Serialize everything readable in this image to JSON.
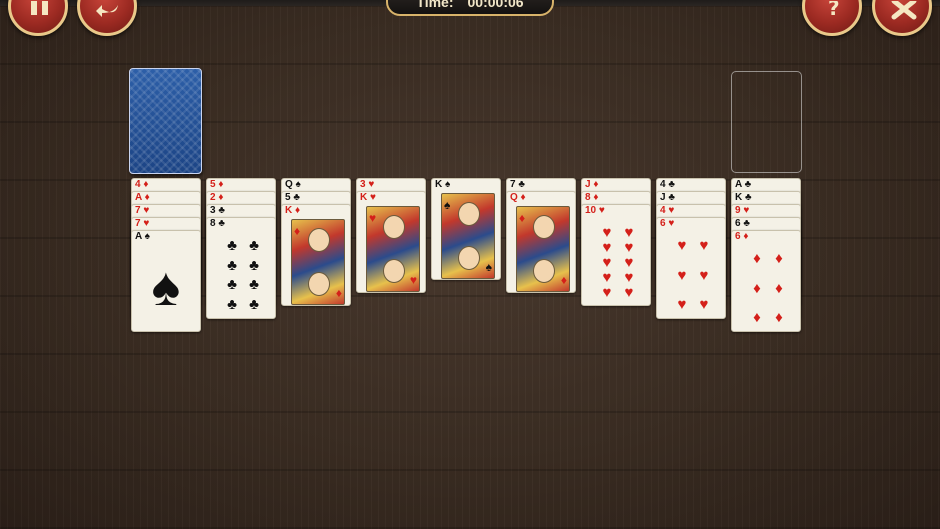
{
  "header": {
    "timer_label": "Time:",
    "timer_value": "00:00:06",
    "pause_icon": "pause-icon",
    "undo_icon": "undo-icon",
    "help_icon": "help-icon",
    "close_icon": "close-icon"
  },
  "colors": {
    "button_red": "#9c2a22",
    "button_border": "#e9c98a",
    "suit_red": "#d4201a",
    "card_back": "#1c4485"
  },
  "tableau": [
    {
      "cards": [
        {
          "rank": "4",
          "suit": "♦"
        },
        {
          "rank": "A",
          "suit": "♦"
        },
        {
          "rank": "7",
          "suit": "♥"
        },
        {
          "rank": "7",
          "suit": "♥"
        },
        {
          "rank": "A",
          "suit": "♠"
        }
      ]
    },
    {
      "cards": [
        {
          "rank": "5",
          "suit": "♦"
        },
        {
          "rank": "2",
          "suit": "♦"
        },
        {
          "rank": "3",
          "suit": "♣"
        },
        {
          "rank": "8",
          "suit": "♣"
        }
      ]
    },
    {
      "cards": [
        {
          "rank": "Q",
          "suit": "♠"
        },
        {
          "rank": "5",
          "suit": "♣"
        },
        {
          "rank": "K",
          "suit": "♦"
        }
      ]
    },
    {
      "cards": [
        {
          "rank": "3",
          "suit": "♥"
        },
        {
          "rank": "K",
          "suit": "♥"
        }
      ]
    },
    {
      "cards": [
        {
          "rank": "K",
          "suit": "♠"
        }
      ]
    },
    {
      "cards": [
        {
          "rank": "7",
          "suit": "♣"
        },
        {
          "rank": "Q",
          "suit": "♦"
        }
      ]
    },
    {
      "cards": [
        {
          "rank": "J",
          "suit": "♦"
        },
        {
          "rank": "8",
          "suit": "♦"
        },
        {
          "rank": "10",
          "suit": "♥"
        }
      ]
    },
    {
      "cards": [
        {
          "rank": "4",
          "suit": "♣"
        },
        {
          "rank": "J",
          "suit": "♣"
        },
        {
          "rank": "4",
          "suit": "♥"
        },
        {
          "rank": "6",
          "suit": "♥"
        }
      ]
    },
    {
      "cards": [
        {
          "rank": "A",
          "suit": "♣"
        },
        {
          "rank": "K",
          "suit": "♣"
        },
        {
          "rank": "9",
          "suit": "♥"
        },
        {
          "rank": "6",
          "suit": "♣"
        },
        {
          "rank": "6",
          "suit": "♦"
        }
      ]
    }
  ]
}
